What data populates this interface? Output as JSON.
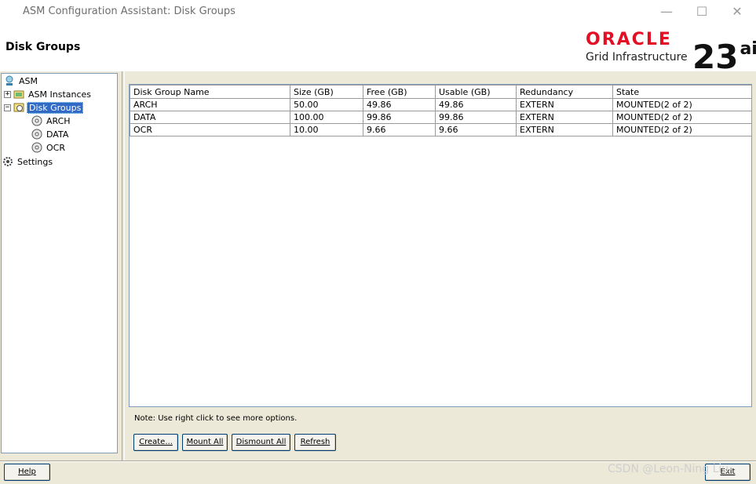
{
  "window": {
    "title": "ASM Configuration Assistant: Disk Groups",
    "controls": {
      "minimize": "—",
      "maximize": "☐",
      "close": "✕"
    }
  },
  "header": {
    "page_title": "Disk Groups",
    "brand": {
      "oracle": "ORACLE",
      "product": "Grid Infrastructure",
      "version": "23",
      "version_sup": "ai"
    }
  },
  "tree": {
    "root": "ASM",
    "asm_instances": "ASM Instances",
    "disk_groups": "Disk Groups",
    "children": [
      "ARCH",
      "DATA",
      "OCR"
    ],
    "settings": "Settings"
  },
  "table": {
    "columns": [
      "Disk Group Name",
      "Size (GB)",
      "Free (GB)",
      "Usable (GB)",
      "Redundancy",
      "State"
    ],
    "rows": [
      [
        "ARCH",
        "50.00",
        "49.86",
        "49.86",
        "EXTERN",
        "MOUNTED(2 of 2)"
      ],
      [
        "DATA",
        "100.00",
        "99.86",
        "99.86",
        "EXTERN",
        "MOUNTED(2 of 2)"
      ],
      [
        "OCR",
        "10.00",
        "9.66",
        "9.66",
        "EXTERN",
        "MOUNTED(2 of 2)"
      ]
    ]
  },
  "note": "Note: Use right click to see more options.",
  "buttons": {
    "create": "Create...",
    "mount_all": "Mount All",
    "dismount_all": "Dismount All",
    "refresh": "Refresh",
    "help": "Help",
    "exit": "Exit"
  },
  "watermark": "CSDN @Leon-Ning Liu",
  "colors": {
    "oracle_red": "#e30f25",
    "selection": "#316ac5",
    "panel_bg": "#ece9d8"
  },
  "icons": [
    "asm-icon",
    "instances-icon",
    "disk-group-icon",
    "disk-icon",
    "gear-icon"
  ]
}
